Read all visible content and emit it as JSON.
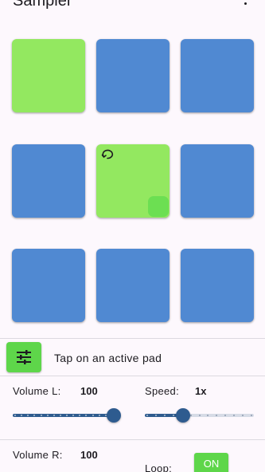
{
  "app": {
    "title": "Sampler",
    "menu_icon": "more-vert-icon"
  },
  "pads": [
    {
      "state": "active",
      "loop": false,
      "playing": false
    },
    {
      "state": "inactive",
      "loop": false,
      "playing": false
    },
    {
      "state": "inactive",
      "loop": false,
      "playing": false
    },
    {
      "state": "inactive",
      "loop": false,
      "playing": false
    },
    {
      "state": "active",
      "loop": true,
      "playing": true
    },
    {
      "state": "inactive",
      "loop": false,
      "playing": false
    },
    {
      "state": "inactive",
      "loop": false,
      "playing": false
    },
    {
      "state": "inactive",
      "loop": false,
      "playing": false
    },
    {
      "state": "inactive",
      "loop": false,
      "playing": false
    }
  ],
  "controls": {
    "settings_icon": "tune-icon",
    "hint": "Tap on an active pad",
    "volume_l": {
      "label": "Volume L:",
      "value": "100",
      "level": 1.0
    },
    "speed": {
      "label": "Speed:",
      "value": "1x",
      "level": 0.33,
      "steps": 3
    },
    "volume_r": {
      "label": "Volume R:",
      "value": "100",
      "level": 1.0
    },
    "loop": {
      "label": "Loop:",
      "toggle": "ON"
    }
  },
  "colors": {
    "pad_active": "#93e860",
    "pad_inactive": "#5089d2",
    "accent_green": "#5ed64a",
    "slider_active": "#2f5c8f",
    "background": "#fdf8fd"
  }
}
